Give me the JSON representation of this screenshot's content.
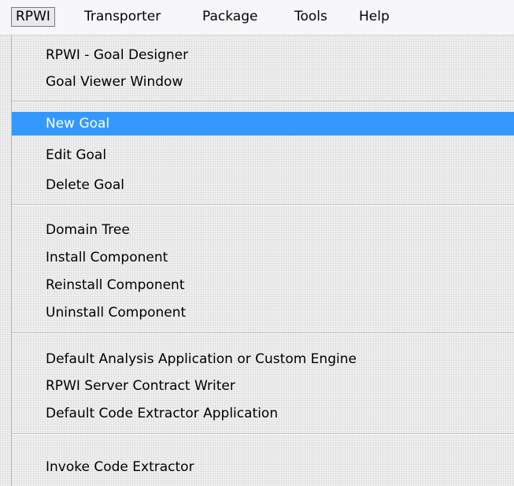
{
  "menubar": {
    "items": [
      {
        "label": "RPWI",
        "active": true
      },
      {
        "label": "Transporter"
      },
      {
        "label": "Package"
      },
      {
        "label": "Tools"
      },
      {
        "label": "Help"
      }
    ]
  },
  "dropdown": {
    "items": [
      {
        "label": "RPWI - Goal Designer"
      },
      {
        "label": "Goal Viewer Window"
      },
      {
        "label": "New Goal",
        "highlighted": true
      },
      {
        "label": "Edit Goal"
      },
      {
        "label": "Delete Goal"
      },
      {
        "label": "Domain Tree"
      },
      {
        "label": "Install Component"
      },
      {
        "label": "Reinstall Component"
      },
      {
        "label": "Uninstall Component"
      },
      {
        "label": "Default Analysis Application or Custom Engine"
      },
      {
        "label": "RPWI Server Contract Writer"
      },
      {
        "label": "Default Code Extractor Application"
      },
      {
        "label": "Invoke Code Extractor"
      }
    ]
  },
  "colors": {
    "highlight": "#3399ff",
    "highlight_text": "#ffffff",
    "menubar_background": "#f7f7f9"
  }
}
